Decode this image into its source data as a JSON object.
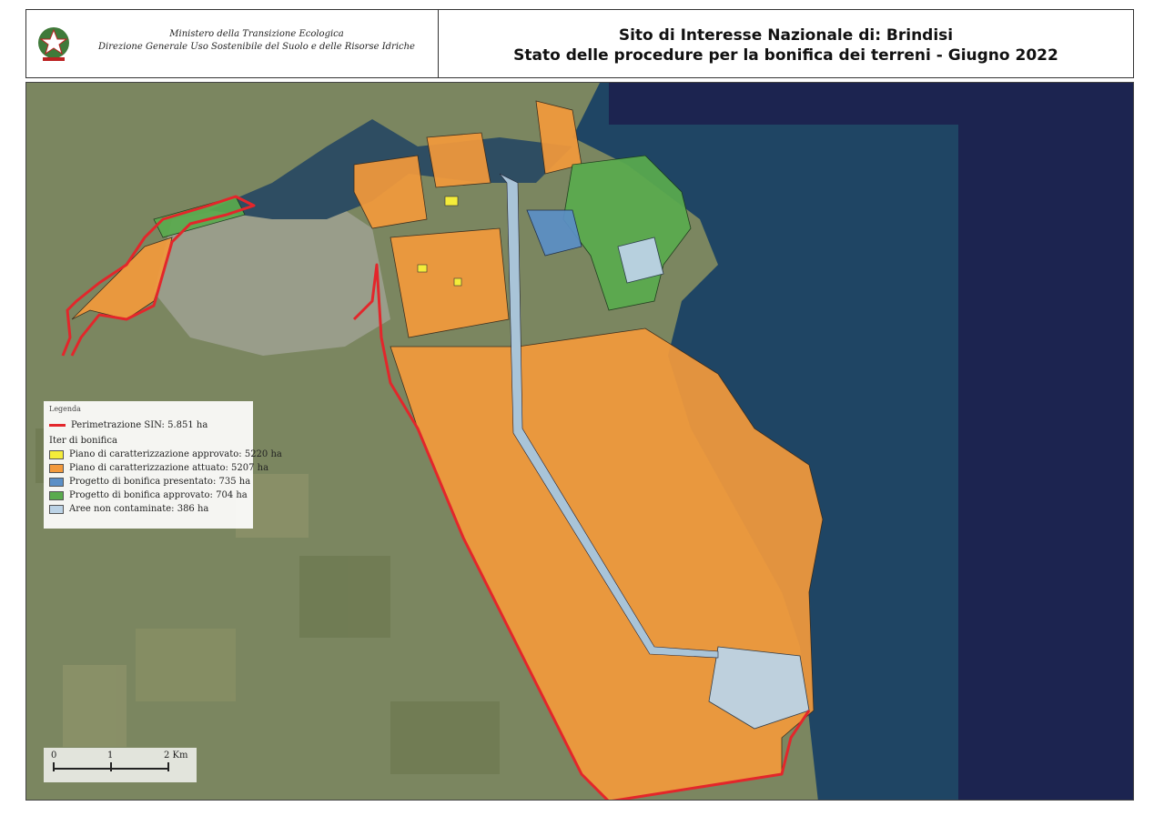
{
  "header": {
    "ministry_line1": "Ministero della Transizione Ecologica",
    "ministry_line2": "Direzione Generale Uso Sostenibile del Suolo e delle Risorse Idriche",
    "title_line1": "Sito di Interesse Nazionale di: Brindisi",
    "title_line2": "Stato delle procedure per la bonifica dei terreni - Giugno 2022"
  },
  "legend": {
    "title": "Legenda",
    "perimeter": {
      "label": "Perimetrazione SIN: 5.851 ha",
      "color": "#e3262b"
    },
    "subtitle": "Iter di bonifica",
    "items": [
      {
        "label": "Piano di caratterizzazione approvato: 5220 ha",
        "color": "#f4ec3a"
      },
      {
        "label": "Piano di caratterizzazione attuato: 5207 ha",
        "color": "#f39a3c"
      },
      {
        "label": "Progetto di bonifica presentato: 735 ha",
        "color": "#5b8fc7"
      },
      {
        "label": "Progetto di bonifica approvato: 704 ha",
        "color": "#5aab4e"
      },
      {
        "label": "Aree non contaminate: 386 ha",
        "color": "#bcd3e6"
      }
    ]
  },
  "scale": {
    "labels": [
      "0",
      "1",
      "2 Km"
    ]
  },
  "colors": {
    "sea": "#1f4564",
    "navy": "#1c2450",
    "land": "#7f8a5f"
  }
}
